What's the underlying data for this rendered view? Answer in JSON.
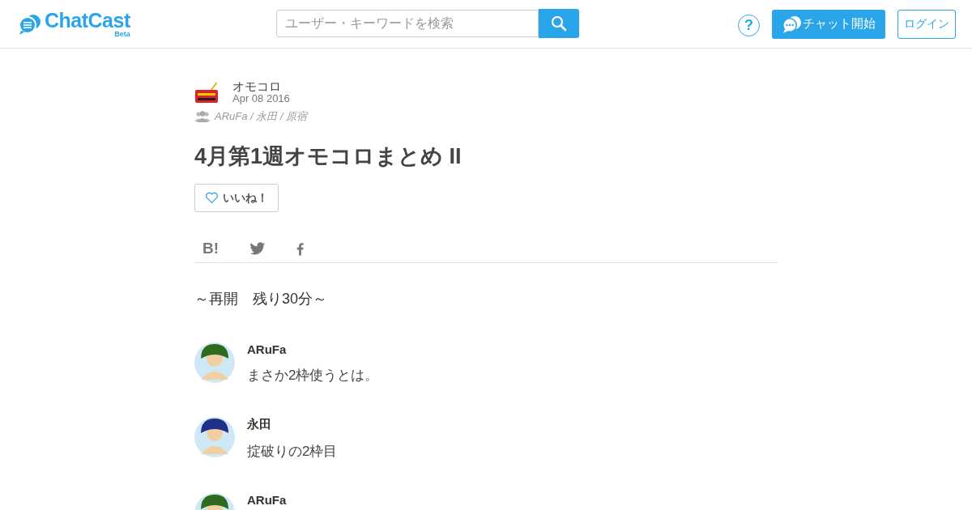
{
  "header": {
    "logo": "ChatCast",
    "logo_badge": "Beta",
    "search": {
      "placeholder": "ユーザー・キーワードを検索"
    },
    "help": "?",
    "start_chat": "チャット開始",
    "login": "ログイン"
  },
  "post": {
    "channel": "オモコロ",
    "date": "Apr 08 2016",
    "members": "ARuFa / 永田 / 原宿",
    "title": "4月第1週オモコロまとめ II",
    "like": {
      "label": "いいね！",
      "liked": false
    },
    "share": [
      "B!"
    ],
    "section": "～再開　残り30分～",
    "messages": [
      {
        "name": "ARuFa",
        "text": "まさか2枠使うとは。",
        "color": "#2e6b1e"
      },
      {
        "name": "永田",
        "text": "掟破りの2枠目",
        "color": "#1f2f8a"
      },
      {
        "name": "ARuFa",
        "color": "#2e6b1e"
      }
    ]
  }
}
